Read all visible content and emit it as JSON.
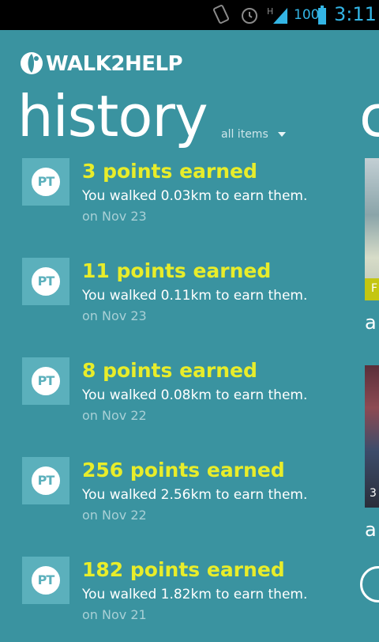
{
  "status_bar": {
    "network_type": "H",
    "battery_text": "100",
    "time": "3:11",
    "icons": [
      "vibrate-icon",
      "alarm-icon",
      "signal-icon",
      "battery-icon"
    ]
  },
  "app": {
    "logo_text": "WALK2HELP"
  },
  "page": {
    "title": "history",
    "filter_label": "all items",
    "next_panel_title_peek": "c"
  },
  "history": [
    {
      "badge": "PT",
      "points": "3 points earned",
      "description": "You walked 0.03km to earn them.",
      "date": "on Nov 23"
    },
    {
      "badge": "PT",
      "points": "11 points earned",
      "description": "You walked 0.11km to earn them.",
      "date": "on Nov 23"
    },
    {
      "badge": "PT",
      "points": "8 points earned",
      "description": "You walked 0.08km to earn them.",
      "date": "on Nov 22"
    },
    {
      "badge": "PT",
      "points": "256 points earned",
      "description": "You walked 2.56km to earn them.",
      "date": "on Nov 22"
    },
    {
      "badge": "PT",
      "points": "182 points earned",
      "description": "You walked 1.82km to earn them.",
      "date": "on Nov 21"
    }
  ],
  "peek": {
    "card1_badge": "F",
    "card1_caption": "a",
    "card2_badge": "3",
    "card2_caption": "a"
  },
  "colors": {
    "background": "#3a93a0",
    "points_text": "#e8ed2a",
    "status_accent": "#33b5e5"
  }
}
